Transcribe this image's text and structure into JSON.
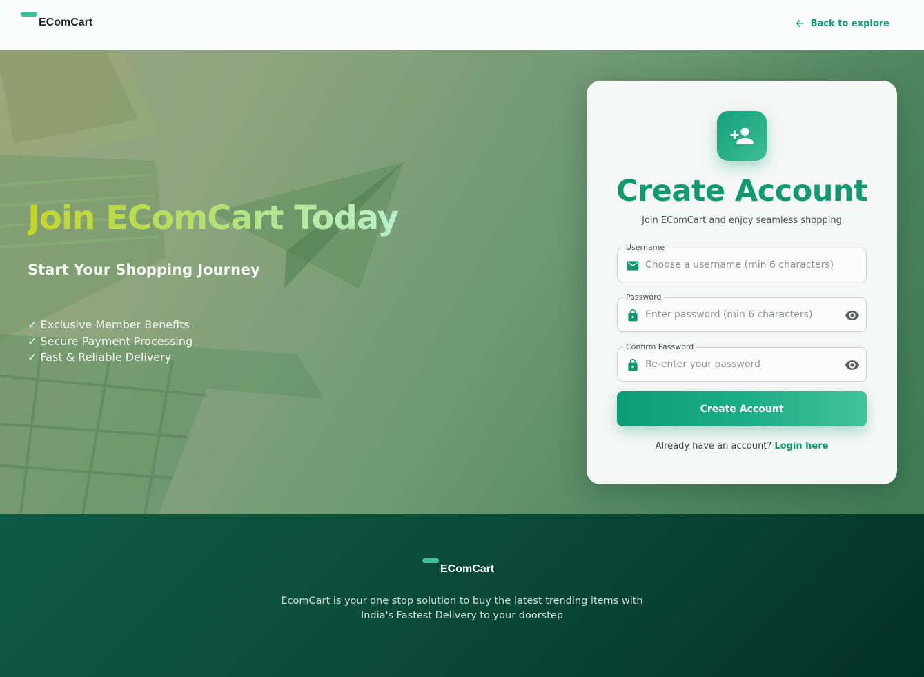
{
  "header": {
    "brand": "EComCart",
    "back_link": "Back to explore"
  },
  "hero": {
    "title": "Join EComCart Today",
    "subtitle": "Start Your Shopping Journey",
    "benefits": [
      "✓ Exclusive Member Benefits",
      "✓ Secure Payment Processing",
      "✓ Fast & Reliable Delivery"
    ]
  },
  "form": {
    "title": "Create Account",
    "subtitle": "Join EComCart and enjoy seamless shopping",
    "username": {
      "label": "Username",
      "placeholder": "Choose a username (min 6 characters)",
      "value": ""
    },
    "password": {
      "label": "Password",
      "placeholder": "Enter password (min 6 characters)",
      "value": ""
    },
    "confirm": {
      "label": "Confirm Password",
      "placeholder": "Re-enter your password",
      "value": ""
    },
    "submit_label": "Create Account",
    "login_prompt": "Already have an account?",
    "login_link": "Login here"
  },
  "footer": {
    "brand": "EComCart",
    "description_line1": "EcomCart is your one stop solution to buy the latest trending items with",
    "description_line2": "India's Fastest Delivery to your doorstep"
  },
  "colors": {
    "accent": "#11996f",
    "accent_light": "#3cc29a",
    "footer_dark": "#043126",
    "title_gradient": [
      "#c6d624",
      "#b6f1cf"
    ]
  },
  "icons": {
    "back": "arrow-left-icon",
    "avatar": "person-add-icon",
    "username": "mail-icon",
    "password": "lock-icon",
    "visibility": "eye-icon"
  }
}
